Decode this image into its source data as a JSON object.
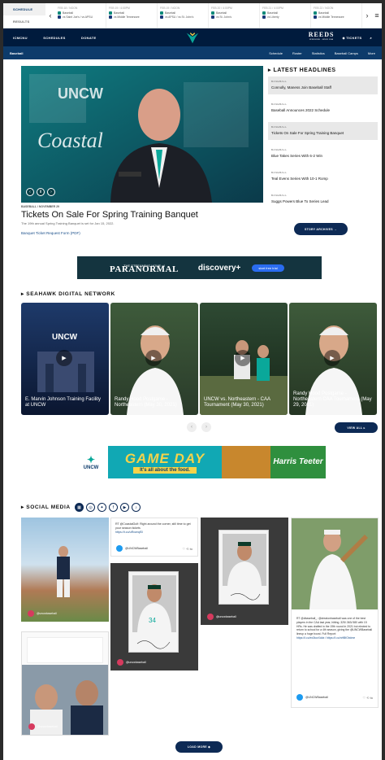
{
  "scoreboard": {
    "tabs": [
      "SCHEDULE",
      "RESULTS"
    ],
    "games": [
      {
        "date": "FEB 18 / NOON",
        "sport": "Baseball",
        "opp": "vs Saint Joe's / vs APSU"
      },
      {
        "date": "FEB 19 / 4:00PM",
        "sport": "Baseball",
        "opp": "vs Middle Tennessee"
      },
      {
        "date": "FEB 19 / NOON",
        "sport": "Baseball",
        "opp": "vs APSU / vs St. John's"
      },
      {
        "date": "FEB 20 / 4:00PM",
        "sport": "Baseball",
        "opp": "vs St. John's"
      },
      {
        "date": "FEB 21 / 4:00PM",
        "sport": "Baseball",
        "opp": "vs Liberty"
      },
      {
        "date": "FEB 22 / NOON",
        "sport": "Baseball",
        "opp": "vs Middle Tennessee"
      }
    ]
  },
  "nav": {
    "items": [
      "ICMCNU",
      "SCHEDULES",
      "DONATE"
    ],
    "sponsor": "REEDS",
    "sponsor_sub": "JEWELERS · SINCE 1946",
    "tickets": "TICKETS",
    "sport": "Baseball",
    "sub_items": [
      "Schedule",
      "Roster",
      "Statistics",
      "Baseball Camps",
      "More"
    ]
  },
  "hero": {
    "meta": "BASEBALL / NOVEMBER 29",
    "title": "Tickets On Sale For Spring Training Banquet",
    "sub": "The 19th annual Spring Training Banquet is set for Jan 15, 2022.",
    "link": "Banquet Ticket Request Form (PDF)"
  },
  "headlines": {
    "title": "LATEST HEADLINES",
    "items": [
      {
        "cat": "BASEBALL",
        "text": "Connolly, Maness Join Baseball Staff"
      },
      {
        "cat": "BASEBALL",
        "text": "Baseball Announces 2022 Schedule"
      },
      {
        "cat": "BASEBALL",
        "text": "Tickets On Sale For Spring Training Banquet"
      },
      {
        "cat": "BASEBALL",
        "text": "Blue Takes Series With 6-2 Win"
      },
      {
        "cat": "BASEBALL",
        "text": "Teal Evens Series With 10-1 Romp"
      },
      {
        "cat": "BASEBALL",
        "text": "Suggs Powers Blue To Series Lead"
      }
    ],
    "archives": "STORY ARCHIVES"
  },
  "ad": {
    "top": "THE STREAMING HOME of",
    "main": "PARANORMAL",
    "brand": "discovery+",
    "cta": "start free trial"
  },
  "digital": {
    "title": "SEAHAWK DIGITAL NETWORK",
    "videos": [
      "E. Marvin Johnson Training Facility at UNCW",
      "Randy Hood Postgame - Northeastern (May 30, 2021)",
      "UNCW vs. Northeastern - CAA Tournament (May 30, 2021)",
      "Randy Hood Postgame - Northeastern CAA Tournament (May 29, 2021)"
    ],
    "view_all": "VIEW ALL"
  },
  "gameday": {
    "unc": "UNCW",
    "title": "GAME DAY",
    "sub": "It's all about the food.",
    "sponsor": "Harris Teeter"
  },
  "social": {
    "title": "SOCIAL MEDIA",
    "tweet1": "RT @CoastalGolf: Right around the corner, still time to get your season tickets",
    "tweet1_link": "https://t.co/uRxwrqlSl",
    "handle_tw": "@UNCWBaseball",
    "handle_ig": "@uncwbaseball",
    "tweet2": "RT @dbaseball_: @dreatonbaseball was one of the best players in the CAA last year, hitting .325/.363/.580 with 15 HRs. He was drafted in the 19th round in 2021 but elected to return to school for a 4th season, giving the @UNCWBaseball lineup a huge boost. Full Report:",
    "tweet2_links": "https://t.co/ex3tuxXddx / https://t.co/nHBfOtxIme",
    "load_more": "LOAD MORE"
  }
}
